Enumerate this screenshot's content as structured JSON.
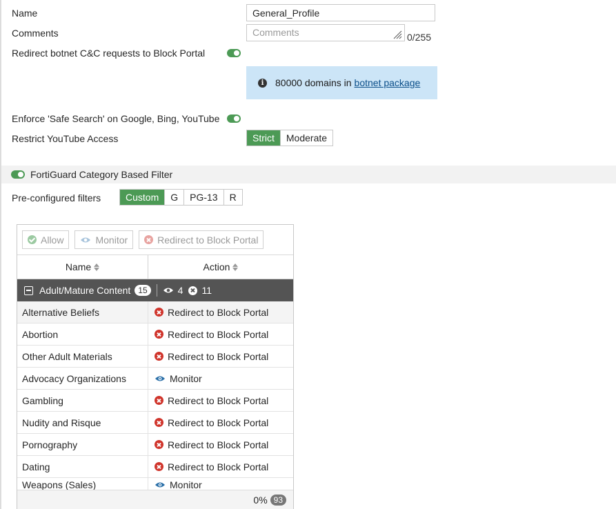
{
  "form": {
    "name_label": "Name",
    "name_value": "General_Profile",
    "comments_label": "Comments",
    "comments_placeholder": "Comments",
    "comments_counter": "0/255",
    "botnet_label": "Redirect botnet C&C requests to Block Portal",
    "botnet_enabled": true,
    "info_text": "80000 domains in",
    "info_link": "botnet package",
    "safe_search_label": "Enforce 'Safe Search' on Google, Bing, YouTube",
    "safe_search_enabled": true,
    "youtube_label": "Restrict YouTube Access",
    "youtube_options": [
      "Strict",
      "Moderate"
    ],
    "youtube_selected": "Strict"
  },
  "fortiguard": {
    "section_label": "FortiGuard Category Based Filter",
    "enabled": true,
    "preconfigured_label": "Pre-configured filters",
    "filters": [
      "Custom",
      "G",
      "PG-13",
      "R"
    ],
    "filter_selected": "Custom"
  },
  "table": {
    "toolbar": {
      "allow_label": "Allow",
      "monitor_label": "Monitor",
      "redirect_label": "Redirect to Block Portal"
    },
    "columns": [
      "Name",
      "Action"
    ],
    "group": {
      "name": "Adult/Mature Content",
      "count": "15",
      "monitor_count": "4",
      "redirect_count": "11"
    },
    "rows": [
      {
        "name": "Alternative Beliefs",
        "action": "Redirect to Block Portal",
        "type": "redirect"
      },
      {
        "name": "Abortion",
        "action": "Redirect to Block Portal",
        "type": "redirect"
      },
      {
        "name": "Other Adult Materials",
        "action": "Redirect to Block Portal",
        "type": "redirect"
      },
      {
        "name": "Advocacy Organizations",
        "action": "Monitor",
        "type": "monitor"
      },
      {
        "name": "Gambling",
        "action": "Redirect to Block Portal",
        "type": "redirect"
      },
      {
        "name": "Nudity and Risque",
        "action": "Redirect to Block Portal",
        "type": "redirect"
      },
      {
        "name": "Pornography",
        "action": "Redirect to Block Portal",
        "type": "redirect"
      },
      {
        "name": "Dating",
        "action": "Redirect to Block Portal",
        "type": "redirect"
      },
      {
        "name": "Weapons (Sales)",
        "action": "Monitor",
        "type": "monitor"
      }
    ],
    "footer_percent": "0%",
    "footer_count": "93"
  },
  "colors": {
    "accent_green": "#4c9a55",
    "info_bg": "#cce5f7",
    "redirect_red": "#d0352c",
    "monitor_blue": "#2a6fa8",
    "group_header_bg": "#545454"
  }
}
